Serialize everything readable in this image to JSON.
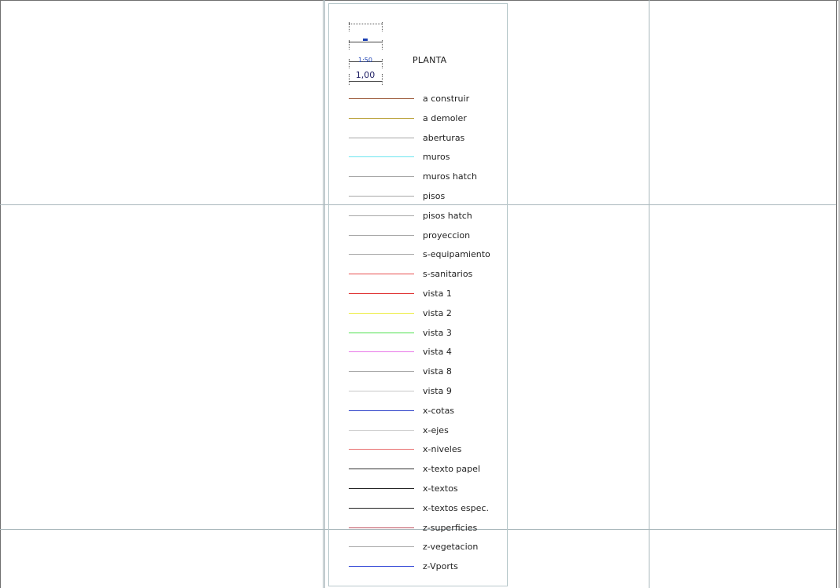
{
  "legend": {
    "title": "PLANTA",
    "scale_labels": [
      "",
      "",
      "1:50",
      "1,00"
    ],
    "layers": [
      {
        "name": "a construir",
        "color": "#9b5a3a"
      },
      {
        "name": "a demoler",
        "color": "#b59a2a"
      },
      {
        "name": "aberturas",
        "color": "#a8a8a8"
      },
      {
        "name": "muros",
        "color": "#6ee6f0"
      },
      {
        "name": "muros hatch",
        "color": "#a8a8a8"
      },
      {
        "name": "pisos",
        "color": "#a8a8a8"
      },
      {
        "name": "pisos hatch",
        "color": "#a8a8a8"
      },
      {
        "name": "proyeccion",
        "color": "#a8a8a8"
      },
      {
        "name": "s-equipamiento",
        "color": "#a8a8a8"
      },
      {
        "name": "s-sanitarios",
        "color": "#e85050"
      },
      {
        "name": "vista 1",
        "color": "#e03030"
      },
      {
        "name": "vista 2",
        "color": "#ecec40"
      },
      {
        "name": "vista 3",
        "color": "#50e050"
      },
      {
        "name": "vista 4",
        "color": "#e878e8"
      },
      {
        "name": "vista 8",
        "color": "#a8a8a8"
      },
      {
        "name": "vista 9",
        "color": "#c8c8c8"
      },
      {
        "name": "x-cotas",
        "color": "#2a3ec8"
      },
      {
        "name": "x-ejes",
        "color": "#cfcfcf"
      },
      {
        "name": "x-niveles",
        "color": "#e87070"
      },
      {
        "name": "x-texto papel",
        "color": "#333333"
      },
      {
        "name": "x-textos",
        "color": "#222222"
      },
      {
        "name": "x-textos espec.",
        "color": "#222222"
      },
      {
        "name": "z-superficies",
        "color": "#c05060"
      },
      {
        "name": "z-vegetacion",
        "color": "#a8a8a8"
      },
      {
        "name": "z-Vports",
        "color": "#3a4ed8"
      }
    ]
  }
}
